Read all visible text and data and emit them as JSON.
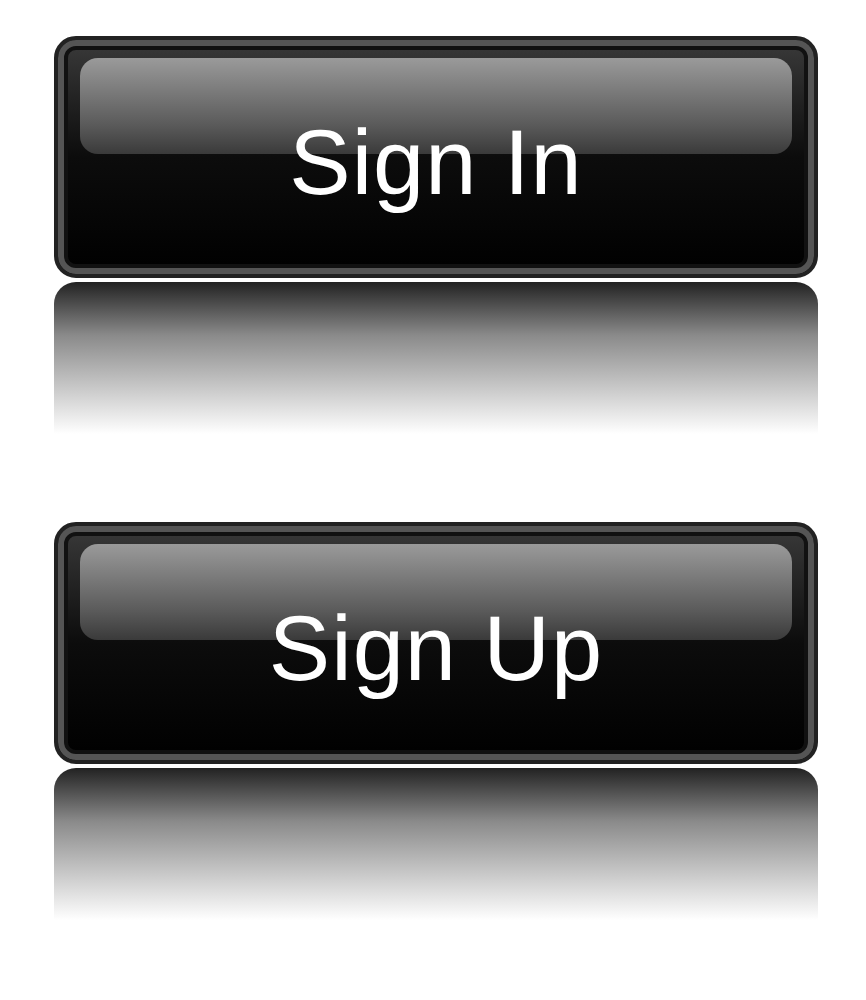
{
  "buttons": [
    {
      "label": "Sign In"
    },
    {
      "label": "Sign Up"
    }
  ]
}
